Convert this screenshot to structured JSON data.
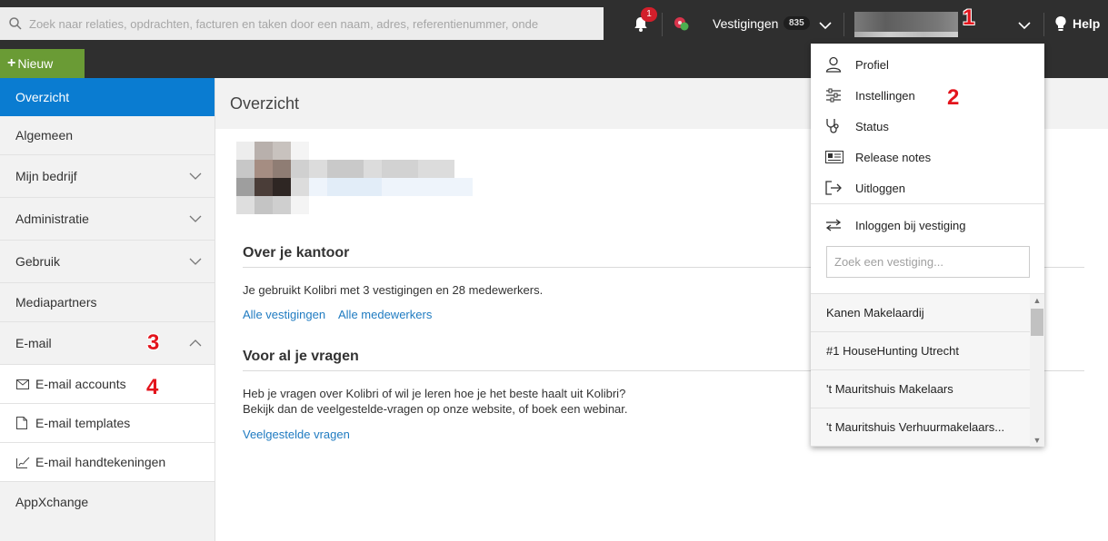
{
  "topbar": {
    "search_placeholder": "Zoek naar relaties, opdrachten, facturen en taken door een naam, adres, referentienummer, onde",
    "notifications_count": "1",
    "branches_label": "Vestigingen",
    "branches_count": "835",
    "help_label": "Help",
    "new_button_label": "Nieuw"
  },
  "sidebar": {
    "items": [
      {
        "label": "Overzicht"
      },
      {
        "label": "Algemeen"
      },
      {
        "label": "Mijn bedrijf"
      },
      {
        "label": "Administratie"
      },
      {
        "label": "Gebruik"
      },
      {
        "label": "Mediapartners"
      },
      {
        "label": "E-mail"
      },
      {
        "label": "AppXchange"
      }
    ],
    "email_sub": [
      {
        "label": "E-mail accounts"
      },
      {
        "label": "E-mail templates"
      },
      {
        "label": "E-mail handtekeningen"
      }
    ]
  },
  "main": {
    "title": "Overzicht",
    "office": {
      "title": "Over je kantoor",
      "text": "Je gebruikt Kolibri met 3 vestigingen en 28 medewerkers.",
      "link_branches": "Alle vestigingen",
      "link_employees": "Alle medewerkers"
    },
    "questions": {
      "title": "Voor al je vragen",
      "line1": "Heb je vragen over Kolibri of wil je leren hoe je het beste haalt uit Kolibri?",
      "line2": "Bekijk dan de veelgestelde-vragen op onze website, of boek een webinar.",
      "link_faq": "Veelgestelde vragen"
    }
  },
  "dropdown": {
    "items": [
      {
        "label": "Profiel",
        "icon": "user-icon"
      },
      {
        "label": "Instellingen",
        "icon": "sliders-icon"
      },
      {
        "label": "Status",
        "icon": "stethoscope-icon"
      },
      {
        "label": "Release notes",
        "icon": "newspaper-icon"
      },
      {
        "label": "Uitloggen",
        "icon": "logout-icon"
      }
    ],
    "login_branch_label": "Inloggen bij vestiging",
    "branch_search_placeholder": "Zoek een vestiging...",
    "branches": [
      "Kanen Makelaardij",
      "#1 HouseHunting Utrecht",
      "'t Mauritshuis Makelaars",
      "'t Mauritshuis Verhuurmakelaars..."
    ]
  },
  "markers": [
    "1",
    "2",
    "3",
    "4"
  ],
  "colors": {
    "topbar": "#2f2f2f",
    "accent_blue": "#0a7cd1",
    "new_button": "#6a9b35",
    "link": "#1f7bc1",
    "marker_red": "#e3141c"
  }
}
